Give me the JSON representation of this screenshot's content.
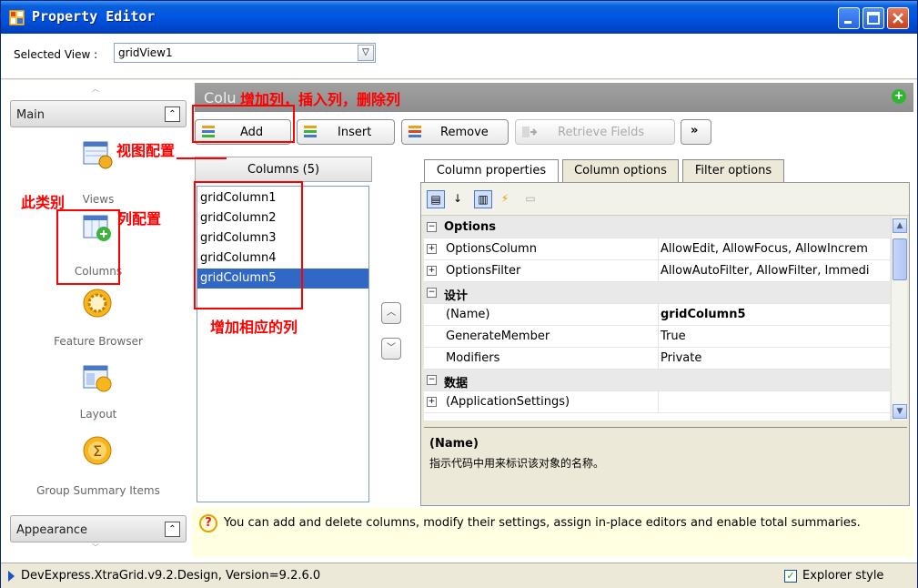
{
  "window": {
    "title": "Property Editor"
  },
  "selector": {
    "label": "Selected View :",
    "value": "gridView1"
  },
  "left_nav": {
    "main_group": "Main",
    "appearance_group": "Appearance",
    "items": [
      {
        "label": "Views",
        "icon": "views-icon"
      },
      {
        "label": "Columns",
        "icon": "columns-icon"
      },
      {
        "label": "Feature Browser",
        "icon": "feature-browser-icon"
      },
      {
        "label": "Layout",
        "icon": "layout-icon"
      },
      {
        "label": "Group Summary Items",
        "icon": "sum-icon"
      }
    ]
  },
  "columns_header": {
    "title": "Colu"
  },
  "toolbar": {
    "add": "Add",
    "insert": "Insert",
    "remove": "Remove",
    "retrieve": "Retrieve Fields",
    "more": "»"
  },
  "columns_list": {
    "header": "Columns (5)",
    "items": [
      "gridColumn1",
      "gridColumn2",
      "gridColumn3",
      "gridColumn4",
      "gridColumn5"
    ],
    "selected": "gridColumn5"
  },
  "tabs": [
    "Column properties",
    "Column options",
    "Filter options"
  ],
  "properties": {
    "rows": [
      {
        "type": "category",
        "label": "Options"
      },
      {
        "type": "prop",
        "expand": "⊞",
        "name": "OptionsColumn",
        "value": "AllowEdit, AllowFocus, AllowIncrem"
      },
      {
        "type": "prop",
        "expand": "⊞",
        "name": "OptionsFilter",
        "value": "AllowAutoFilter, AllowFilter, Immedi"
      },
      {
        "type": "category",
        "label": "设计"
      },
      {
        "type": "prop",
        "expand": "",
        "name": "(Name)",
        "value": "gridColumn5",
        "bold": true
      },
      {
        "type": "prop",
        "expand": "",
        "name": "GenerateMember",
        "value": "True"
      },
      {
        "type": "prop",
        "expand": "",
        "name": "Modifiers",
        "value": "Private"
      },
      {
        "type": "category",
        "label": "数据"
      },
      {
        "type": "prop",
        "expand": "⊞",
        "name": "(ApplicationSettings)",
        "value": ""
      }
    ],
    "desc_title": "(Name)",
    "desc_body": "指示代码中用来标识该对象的名称。"
  },
  "hint": {
    "text": "You can add and delete columns, modify their settings, assign in-place editors and enable total summaries."
  },
  "status": {
    "text": "DevExpress.XtraGrid.v9.2.Design, Version=9.2.6.0",
    "explorer_style_label": "Explorer style",
    "explorer_style_checked": true
  },
  "annotations": {
    "add_insert_remove": "增加列，插入列，删除列",
    "view_config": "视图配置",
    "this_category": "此类别",
    "column_config": "列配置",
    "add_corresponding": "增加相应的列"
  },
  "colors": {
    "title_blue": "#0055e5",
    "selection": "#3168c6",
    "annotation_red": "#ff0000",
    "hint_bg": "#ffffe1"
  }
}
